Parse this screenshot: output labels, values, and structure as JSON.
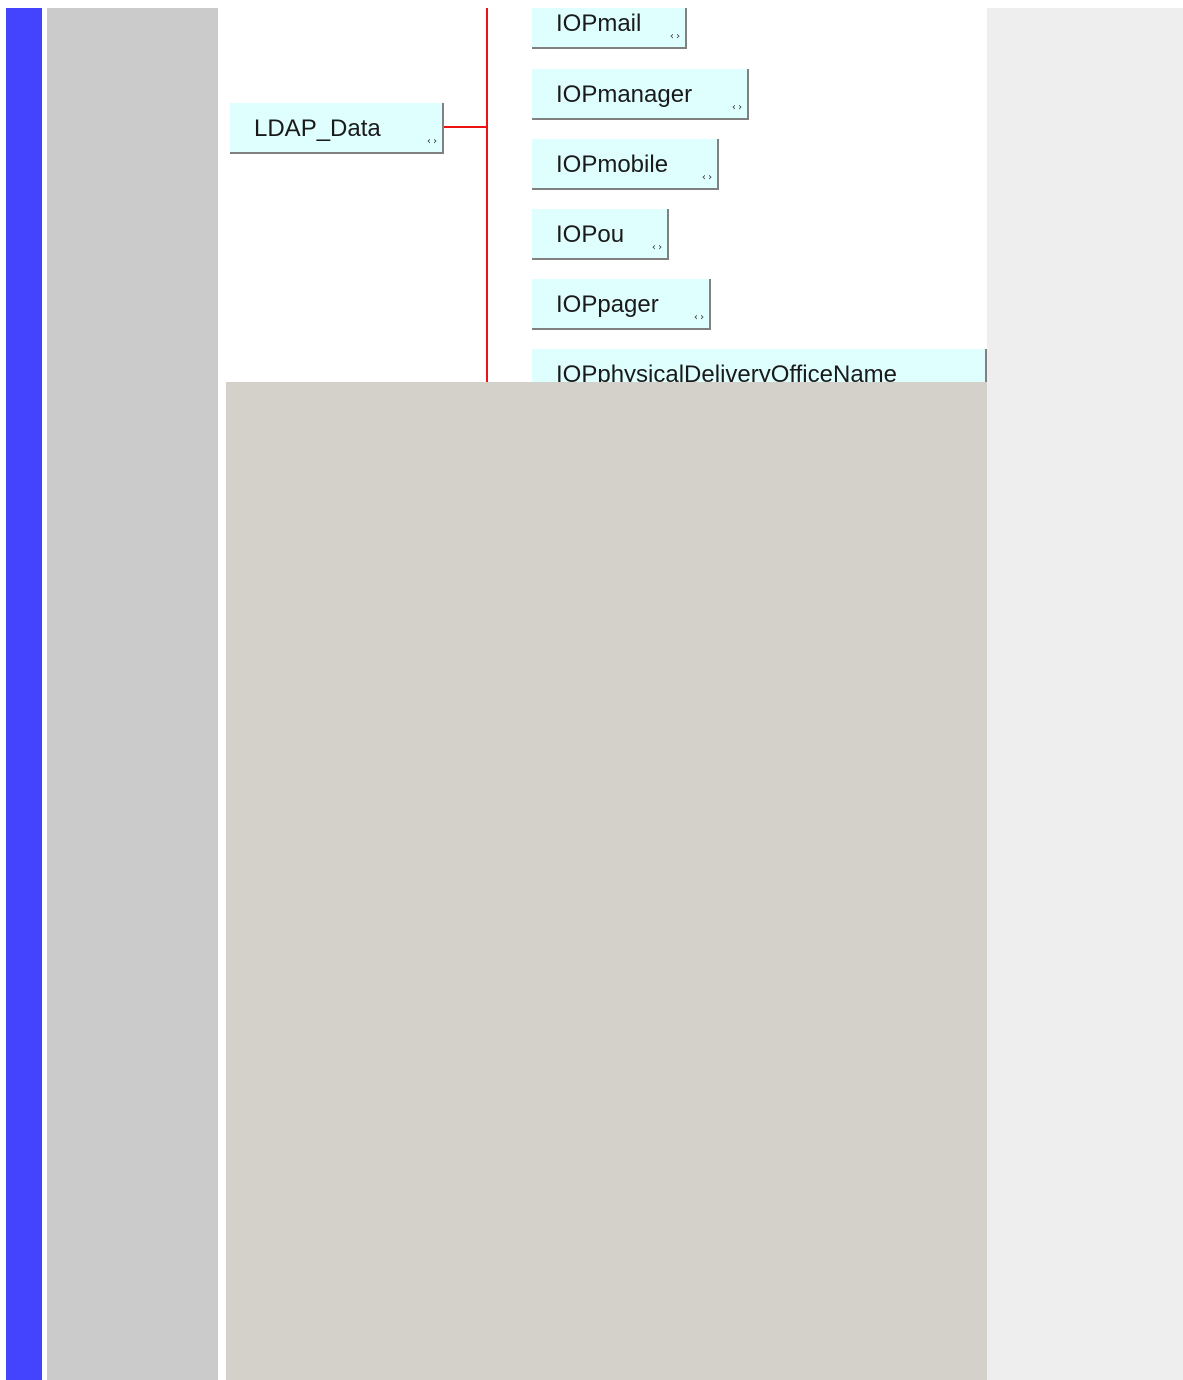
{
  "colors": {
    "accent_bar": "#4444ff",
    "side_panel": "#cbcbcb",
    "right_panel": "#eeeeee",
    "lower_area": "#d4d0ca",
    "node_fill": "#dffefe",
    "connector": "#ee1111"
  },
  "diagram": {
    "root": {
      "label": "LDAP_Data",
      "expand_icon": "expand-collapse-icon"
    },
    "children": [
      {
        "label": "IOPmail"
      },
      {
        "label": "IOPmanager"
      },
      {
        "label": "IOPmobile"
      },
      {
        "label": "IOPou"
      },
      {
        "label": "IOPpager"
      },
      {
        "label": "IOPphysicalDeliveryOfficeName"
      }
    ],
    "expand_glyph": "‹›"
  }
}
